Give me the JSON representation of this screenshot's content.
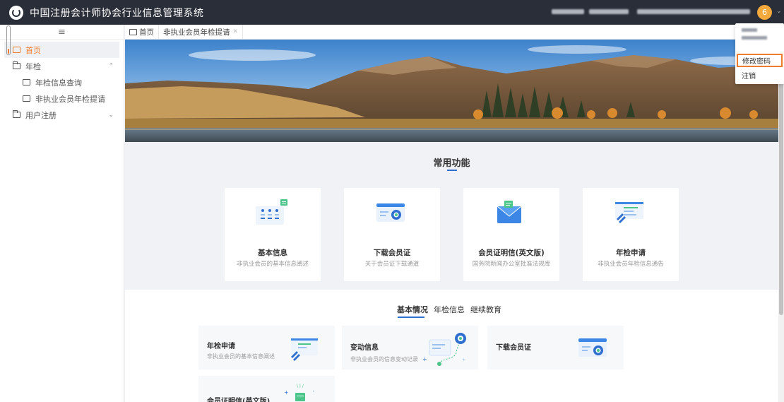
{
  "header": {
    "title": "中国注册会计师协会行业信息管理系统",
    "notification_count": "6"
  },
  "sidebar": {
    "items": [
      {
        "label": "首页"
      },
      {
        "label": "年检"
      },
      {
        "label": "年检信息查询"
      },
      {
        "label": "非执业会员年检提请"
      },
      {
        "label": "用户注册"
      }
    ]
  },
  "tabs": [
    {
      "label": "首页"
    },
    {
      "label": "非执业会员年检提请"
    }
  ],
  "common": {
    "title": "常用功能",
    "cards": [
      {
        "title": "基本信息",
        "desc": "非执业会员的基本信息阐述"
      },
      {
        "title": "下载会员证",
        "desc": "关于会员证下载通道"
      },
      {
        "title": "会员证明信(英文版)",
        "desc": "国务院新闻办公室批准法规库"
      },
      {
        "title": "年检申请",
        "desc": "非执业会员年检信息通告"
      }
    ]
  },
  "lower": {
    "tabs": [
      {
        "label": "基本情况"
      },
      {
        "label": "年检信息"
      },
      {
        "label": "继续教育"
      }
    ],
    "cards": [
      {
        "title": "年检申请",
        "desc": "非执业会员的基本信息阐述"
      },
      {
        "title": "变动信息",
        "desc": "非执业会员的信息变动记录"
      },
      {
        "title": "下载会员证",
        "desc": ""
      },
      {
        "title": "会员证明信(英文版)",
        "desc": ""
      }
    ]
  },
  "dropdown": {
    "items": [
      {
        "label": "修改密码"
      },
      {
        "label": "注销"
      }
    ]
  },
  "colors": {
    "header_bg": "#2a2e38",
    "accent": "#f07b2b",
    "primary_blue": "#2f6fcf",
    "badge": "#f3a93b"
  }
}
